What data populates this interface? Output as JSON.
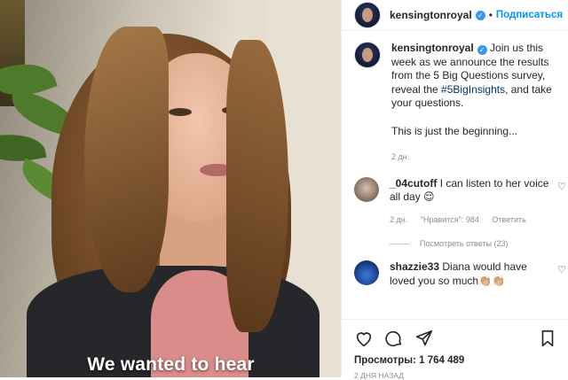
{
  "header": {
    "username": "kensingtonroyal",
    "follow_label": "Подписаться"
  },
  "caption": {
    "username": "kensingtonroyal",
    "text_before_tag": "Join us this week as we announce the results from the 5 Big Questions survey, reveal the",
    "hashtag": "#5BigInsights",
    "text_after_tag": ", and take your questions.",
    "paragraph2": "This is just the beginning...",
    "time": "2 дн."
  },
  "comments": [
    {
      "username": "_04cutoff",
      "text": "I can listen to her voice all day 😌",
      "time": "2 дн.",
      "likes": "\"Нравится\": 984",
      "reply_label": "Ответить",
      "view_replies": "Посмотреть ответы (23)"
    },
    {
      "username": "shazzie33",
      "text": "Diana would have loved you so much👏🏼👏🏼"
    }
  ],
  "video": {
    "subtitle": "We wanted to hear"
  },
  "stats": {
    "views": "Просмотры: 1 764 489",
    "time": "2 ДНЯ НАЗАД"
  },
  "icons": [
    "verified-badge",
    "heart-icon",
    "comment-icon",
    "share-icon",
    "bookmark-icon"
  ]
}
